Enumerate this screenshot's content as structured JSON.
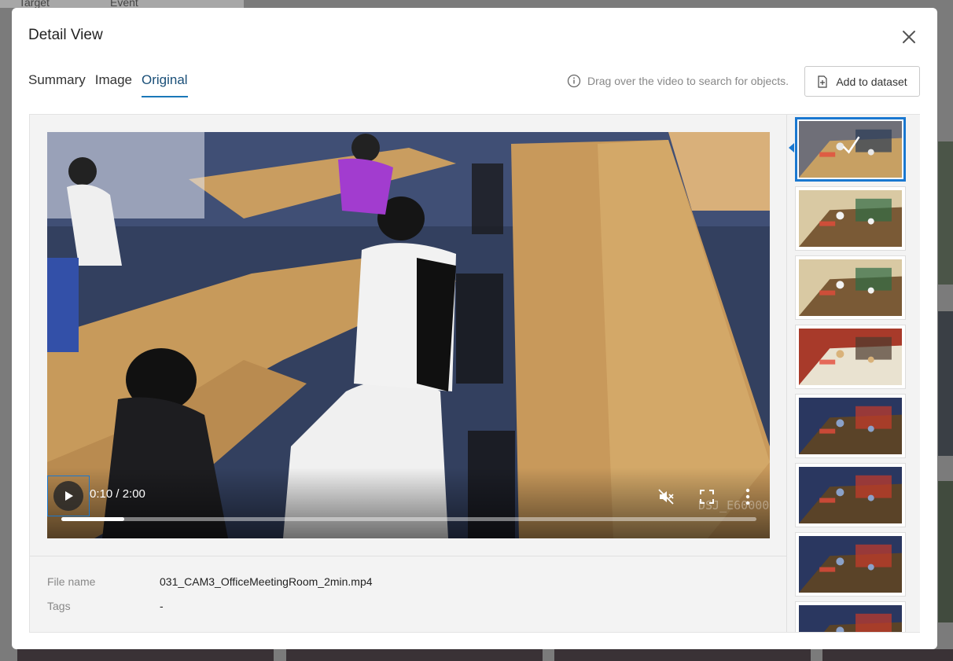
{
  "modal": {
    "title": "Detail View",
    "close_icon": "close-icon"
  },
  "tabs": [
    {
      "label": "Summary",
      "active": false
    },
    {
      "label": "Image",
      "active": false
    },
    {
      "label": "Original",
      "active": true
    }
  ],
  "hint": {
    "icon": "info-icon",
    "text": "Drag over the video to search for objects."
  },
  "add_button": {
    "icon": "add-to-dataset-icon",
    "label": "Add to dataset"
  },
  "background": {
    "tab_labels": [
      "Target",
      "Event"
    ]
  },
  "player": {
    "current_time": "0:10",
    "duration": "2:00",
    "time_display": "0:10 / 2:00",
    "progress": 0.09,
    "muted": true,
    "watermark": "DSJ_E60000",
    "icons": [
      "play-icon",
      "mute-icon",
      "fullscreen-icon",
      "more-vertical-icon"
    ]
  },
  "meta": {
    "file_name_label": "File name",
    "file_name_value": "031_CAM3_OfficeMeetingRoom_2min.mp4",
    "tags_label": "Tags",
    "tags_value": "-"
  },
  "thumbnails": [
    {
      "scene": "office",
      "selected": true
    },
    {
      "scene": "cafe",
      "selected": false
    },
    {
      "scene": "cafe",
      "selected": false
    },
    {
      "scene": "classroom",
      "selected": false
    },
    {
      "scene": "night",
      "selected": false
    },
    {
      "scene": "night",
      "selected": false
    },
    {
      "scene": "night",
      "selected": false
    },
    {
      "scene": "night",
      "selected": false
    }
  ],
  "colors": {
    "accent": "#1a78d0",
    "tab_active": "#1a4f78"
  }
}
